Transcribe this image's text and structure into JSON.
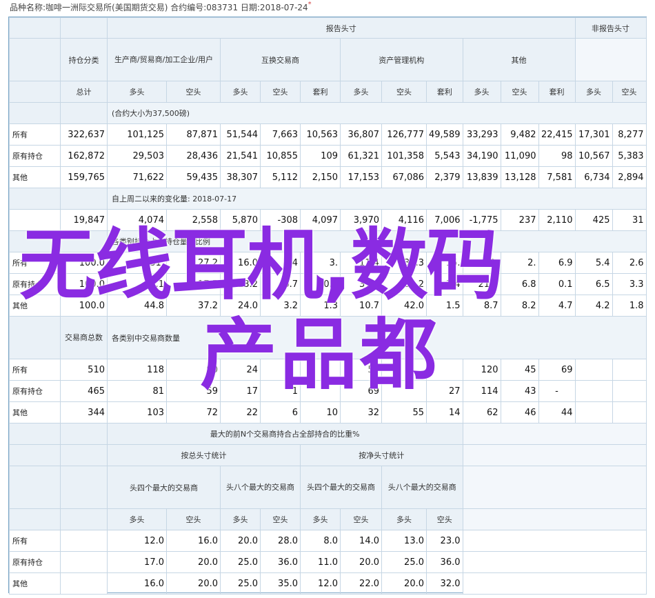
{
  "caption": {
    "text": "品种名称:咖啡一洲际交易所(美国期货交易)   合约编号:083731   日期:2018-07-24",
    "mark": "*"
  },
  "headers": {
    "hold_class": "持仓分类",
    "reportable": "报告头寸",
    "nonreportable": "非报告头寸",
    "producer": "生产商/贸易商/加工企业/用户",
    "swap": "互换交易商",
    "managed": "资产管理机构",
    "other": "其他",
    "total": "总计",
    "long": "多头",
    "short": "空头",
    "spread": "套利"
  },
  "rows_labels": {
    "all": "所有",
    "old": "原有持仓",
    "other": "其他"
  },
  "notes": {
    "contract_size": "(合约大小为37,500磅)",
    "change": "自上周二以来的变化量:  2018-07-17",
    "pct_total": "各类别持仓占总持仓量的比例",
    "traders_total": "交易商总数",
    "traders_by_cat": "各类别中交易商数量"
  },
  "positions": [
    [
      "322,637",
      "101,125",
      "87,871",
      "51,544",
      "7,663",
      "10,563",
      "36,807",
      "126,777",
      "49,589",
      "33,293",
      "9,482",
      "22,415",
      "17,301",
      "8,277"
    ],
    [
      "162,872",
      "29,503",
      "28,436",
      "21,541",
      "10,855",
      "109",
      "61,321",
      "101,358",
      "5,543",
      "34,190",
      "11,090",
      "98",
      "10,567",
      "5,383"
    ],
    [
      "159,765",
      "71,622",
      "59,435",
      "38,307",
      "5,112",
      "2,150",
      "17,153",
      "67,086",
      "2,379",
      "13,839",
      "13,128",
      "7,581",
      "6,734",
      "2,894"
    ]
  ],
  "changes": [
    "19,847",
    "4,074",
    "2,558",
    "5,870",
    "-308",
    "4,097",
    "3,970",
    "4,116",
    "7,006",
    "-1,775",
    "237",
    "2,110",
    "425",
    "31"
  ],
  "percents": [
    [
      "100.0",
      "31.",
      "27.2",
      "16.0",
      "2.4",
      "3.",
      "11.4",
      "39.3",
      "15.",
      "10.",
      "2.",
      "6.9",
      "5.4",
      "2.6"
    ],
    [
      "100.0",
      "18.1",
      "17.5",
      "13.2",
      "6.7",
      "0.1",
      "37.6",
      "62.2",
      "3.4",
      "21.0",
      "6.8",
      "0.1",
      "6.5",
      "3.3"
    ],
    [
      "100.0",
      "44.8",
      "37.2",
      "24.0",
      "3.2",
      "1.3",
      "10.7",
      "42.0",
      "1.5",
      "8.7",
      "8.2",
      "4.7",
      "4.2",
      "1.8"
    ]
  ],
  "traders": [
    [
      "510",
      "118",
      "90",
      "24",
      "",
      "",
      "57",
      "",
      "",
      "120",
      "45",
      "69"
    ],
    [
      "465",
      "81",
      "59",
      "17",
      "1",
      "",
      "69",
      "",
      "27",
      "114",
      "43",
      "-"
    ],
    [
      "344",
      "103",
      "72",
      "22",
      "6",
      "10",
      "32",
      "55",
      "14",
      "62",
      "46",
      "44"
    ]
  ],
  "concentration": {
    "title": "最大的前N个交易商持合占全部持合的比重%",
    "by_gross": "按总头寸统计",
    "by_net": "按净头寸统计",
    "top4": "头四个最大的交易商",
    "top8": "头八个最大的交易商",
    "rows": [
      [
        "12.0",
        "16.0",
        "20.0",
        "28.0",
        "8.0",
        "14.0",
        "13.0",
        "23.0"
      ],
      [
        "17.0",
        "20.0",
        "25.0",
        "36.0",
        "11.0",
        "20.0",
        "25.0",
        "36.0"
      ],
      [
        "16.0",
        "20.0",
        "25.0",
        "35.0",
        "12.0",
        "22.0",
        "20.0",
        "32.0"
      ]
    ]
  },
  "overlay": {
    "line1": "无线耳机,数码",
    "line2": "产品都"
  }
}
